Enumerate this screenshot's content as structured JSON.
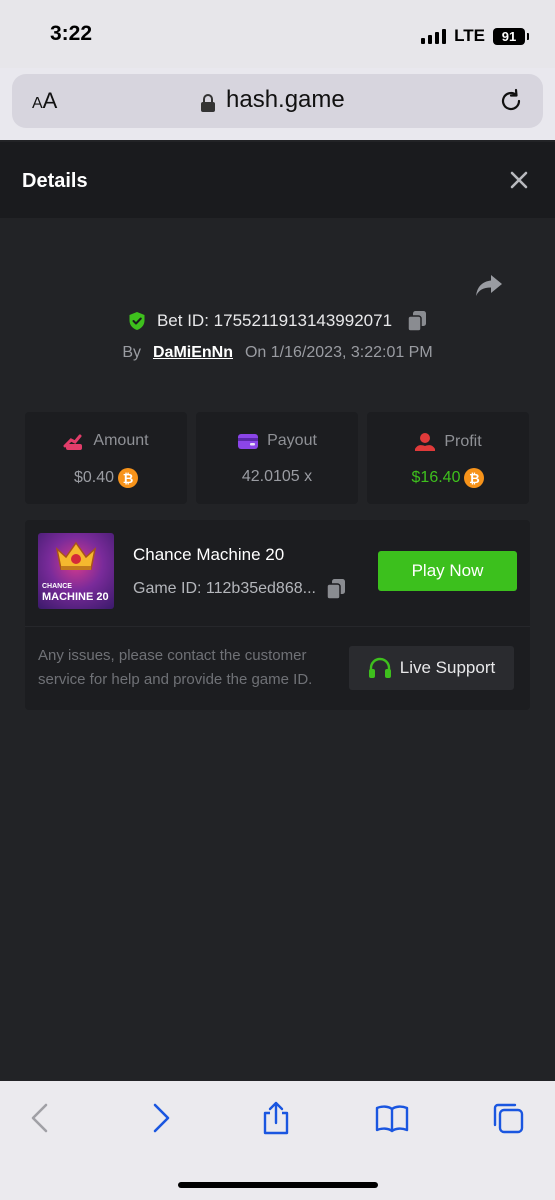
{
  "status_bar": {
    "time": "3:22",
    "network": "LTE",
    "battery": "91"
  },
  "browser": {
    "text_size_label": "AA",
    "url": "hash.game"
  },
  "details": {
    "title": "Details",
    "bet_id_label": "Bet ID:",
    "bet_id": "1755211913143992071",
    "by_label": "By",
    "username": "DaMiEnNn",
    "on_label": "On",
    "datetime": "1/16/2023, 3:22:01 PM"
  },
  "stats": [
    {
      "label": "Amount",
      "value": "$0.40",
      "coin": true,
      "color": "#9a9ca2"
    },
    {
      "label": "Payout",
      "value": "42.0105 x",
      "coin": false,
      "color": "#9a9ca2"
    },
    {
      "label": "Profit",
      "value": "$16.40",
      "coin": true,
      "color": "#3ec01d"
    }
  ],
  "game": {
    "thumb_line1": "CHANCE",
    "thumb_line2": "MACHINE 20",
    "name": "Chance Machine 20",
    "game_id_label": "Game ID:",
    "game_id": "112b35ed868...",
    "play_label": "Play Now"
  },
  "support": {
    "message": "Any issues, please contact the customer service for help and provide the game ID.",
    "button_label": "Live Support"
  },
  "colors": {
    "accent_green": "#3cc01d",
    "card_bg": "#1c1d20",
    "page_bg": "#222326"
  }
}
